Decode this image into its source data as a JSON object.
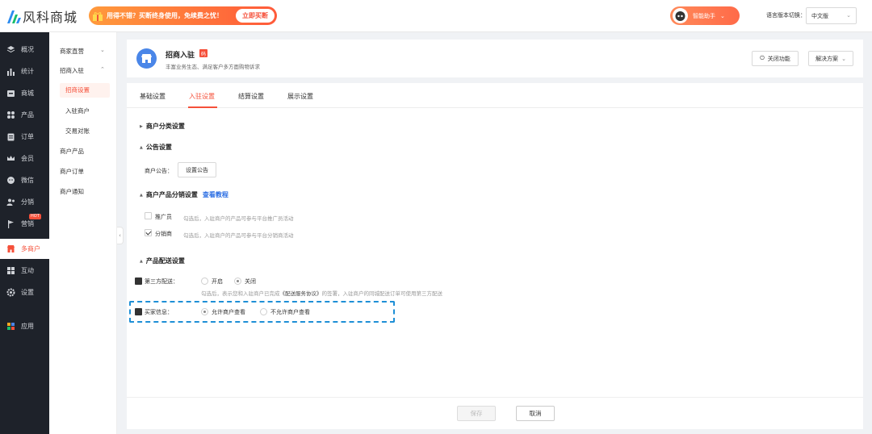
{
  "brand": {
    "name": "风科商城"
  },
  "promo": {
    "text": "用得不错？买断终身使用，免续费之忧！",
    "button": "立即买断"
  },
  "assistant": {
    "label": "智能助手"
  },
  "language": {
    "label": "语言版本切换：",
    "value": "中文版"
  },
  "sidenav": [
    {
      "label": "概况",
      "icon": "layers-icon"
    },
    {
      "label": "统计",
      "icon": "chart-icon"
    },
    {
      "label": "商城",
      "icon": "store-icon"
    },
    {
      "label": "产品",
      "icon": "grid-icon"
    },
    {
      "label": "订单",
      "icon": "clipboard-icon"
    },
    {
      "label": "会员",
      "icon": "crown-icon"
    },
    {
      "label": "微信",
      "icon": "wechat-icon"
    },
    {
      "label": "分销",
      "icon": "users-icon"
    },
    {
      "label": "营销",
      "icon": "flag-icon",
      "badge": "HOT"
    },
    {
      "label": "多商户",
      "icon": "shop-icon"
    },
    {
      "label": "互动",
      "icon": "apps-icon"
    },
    {
      "label": "设置",
      "icon": "gear-icon"
    },
    {
      "label": "应用",
      "icon": "app-grid-icon"
    }
  ],
  "submenu": {
    "group1": "商家直营",
    "group2": "招商入驻",
    "children": [
      "招商设置",
      "入驻商户",
      "交易对账"
    ],
    "others": [
      "商户产品",
      "商户订单",
      "商户通知"
    ]
  },
  "header": {
    "title": "招商入驻",
    "badge": "码",
    "subtitle": "丰富业务生态、满足客户多方面购物诉求",
    "close_btn": "关闭功能",
    "solution_btn": "解决方案"
  },
  "tabs": [
    "基础设置",
    "入驻设置",
    "结算设置",
    "展示设置"
  ],
  "sections": {
    "category": "商户分类设置",
    "notice": "公告设置",
    "notice_label": "商户公告：",
    "notice_btn": "设置公告",
    "distribution": "商户产品分销设置",
    "distribution_link": "查看教程",
    "promoter_label": "推广员",
    "promoter_hint": "勾选后，入驻商户的产品可参与平台推广员活动",
    "distributor_label": "分销商",
    "distributor_hint": "勾选后，入驻商户的产品可参与平台分销商活动",
    "delivery": "产品配送设置",
    "third_party_label": "第三方配送：",
    "open": "开启",
    "close": "关闭",
    "delivery_hint_pre": "勾选后，表示您和入驻商户已完成",
    "delivery_hint_link": "《配送服务协议》",
    "delivery_hint_post": "的签署，入驻商户的同城配送订单可使用第三方配送",
    "buyer_label": "买家信息：",
    "allow": "允许商户查看",
    "deny": "不允许商户查看"
  },
  "footer": {
    "save": "保存",
    "cancel": "取消"
  },
  "colors": {
    "accent": "#f5503a",
    "link": "#2d6fe3",
    "nav_bg": "#1e222a",
    "highlight_border": "#1e8fd6"
  }
}
